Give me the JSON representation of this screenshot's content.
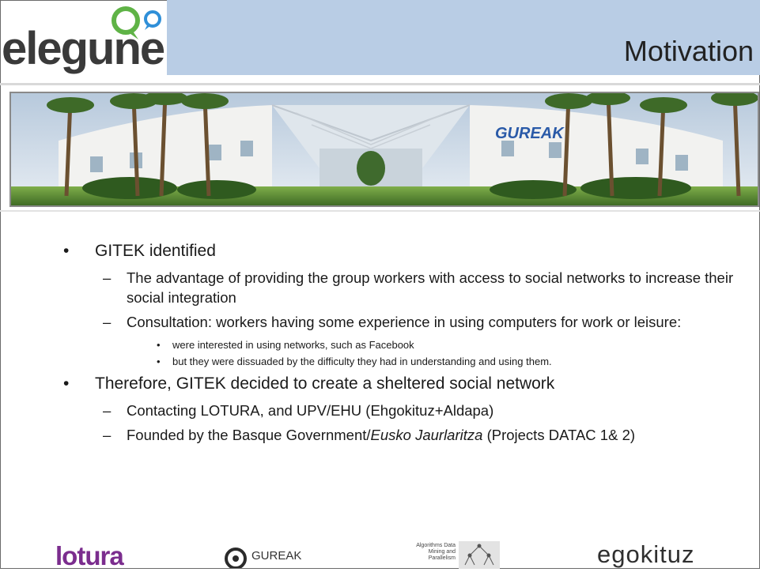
{
  "header": {
    "logo_text": "elegune",
    "title": "Motivation"
  },
  "photo": {
    "sign_text": "GUREAK"
  },
  "bullets": [
    {
      "text": "GITEK identified",
      "children": [
        {
          "text": "The advantage of providing the group workers with access to social networks to increase their social integration",
          "children": []
        },
        {
          "text": "Consultation: workers having some experience in using computers for work or leisure:",
          "children": [
            "were interested in using networks, such as Facebook",
            "but they were dissuaded by the difficulty they had in understanding and using them."
          ]
        }
      ]
    },
    {
      "text": "Therefore, GITEK decided to create a sheltered social network",
      "children": [
        {
          "text": "Contacting LOTURA, and UPV/EHU (Ehgokituz+Aldapa)",
          "children": []
        },
        {
          "text_before": "Founded by the Basque Government/",
          "text_italic": "Eusko Jaurlaritza",
          "text_after": " (Projects DATAC 1& 2)",
          "children": []
        }
      ]
    }
  ],
  "footer": {
    "lotura": "lotura",
    "gureak": "GUREAK",
    "aldapa_text": "Algorithms Data Mining and Parallelism",
    "egokituz": "egokituz"
  },
  "colors": {
    "title_band": "#b9cde5",
    "lotura_purple": "#7b2d8e",
    "logo_green": "#5fb346",
    "logo_blue": "#2f8fd8"
  }
}
